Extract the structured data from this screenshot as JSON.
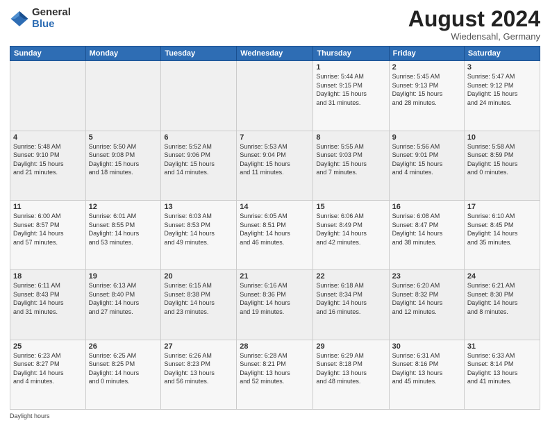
{
  "header": {
    "logo_general": "General",
    "logo_blue": "Blue",
    "title": "August 2024",
    "location": "Wiedensahl, Germany"
  },
  "days_of_week": [
    "Sunday",
    "Monday",
    "Tuesday",
    "Wednesday",
    "Thursday",
    "Friday",
    "Saturday"
  ],
  "weeks": [
    [
      {
        "day": "",
        "info": ""
      },
      {
        "day": "",
        "info": ""
      },
      {
        "day": "",
        "info": ""
      },
      {
        "day": "",
        "info": ""
      },
      {
        "day": "1",
        "info": "Sunrise: 5:44 AM\nSunset: 9:15 PM\nDaylight: 15 hours\nand 31 minutes."
      },
      {
        "day": "2",
        "info": "Sunrise: 5:45 AM\nSunset: 9:13 PM\nDaylight: 15 hours\nand 28 minutes."
      },
      {
        "day": "3",
        "info": "Sunrise: 5:47 AM\nSunset: 9:12 PM\nDaylight: 15 hours\nand 24 minutes."
      }
    ],
    [
      {
        "day": "4",
        "info": "Sunrise: 5:48 AM\nSunset: 9:10 PM\nDaylight: 15 hours\nand 21 minutes."
      },
      {
        "day": "5",
        "info": "Sunrise: 5:50 AM\nSunset: 9:08 PM\nDaylight: 15 hours\nand 18 minutes."
      },
      {
        "day": "6",
        "info": "Sunrise: 5:52 AM\nSunset: 9:06 PM\nDaylight: 15 hours\nand 14 minutes."
      },
      {
        "day": "7",
        "info": "Sunrise: 5:53 AM\nSunset: 9:04 PM\nDaylight: 15 hours\nand 11 minutes."
      },
      {
        "day": "8",
        "info": "Sunrise: 5:55 AM\nSunset: 9:03 PM\nDaylight: 15 hours\nand 7 minutes."
      },
      {
        "day": "9",
        "info": "Sunrise: 5:56 AM\nSunset: 9:01 PM\nDaylight: 15 hours\nand 4 minutes."
      },
      {
        "day": "10",
        "info": "Sunrise: 5:58 AM\nSunset: 8:59 PM\nDaylight: 15 hours\nand 0 minutes."
      }
    ],
    [
      {
        "day": "11",
        "info": "Sunrise: 6:00 AM\nSunset: 8:57 PM\nDaylight: 14 hours\nand 57 minutes."
      },
      {
        "day": "12",
        "info": "Sunrise: 6:01 AM\nSunset: 8:55 PM\nDaylight: 14 hours\nand 53 minutes."
      },
      {
        "day": "13",
        "info": "Sunrise: 6:03 AM\nSunset: 8:53 PM\nDaylight: 14 hours\nand 49 minutes."
      },
      {
        "day": "14",
        "info": "Sunrise: 6:05 AM\nSunset: 8:51 PM\nDaylight: 14 hours\nand 46 minutes."
      },
      {
        "day": "15",
        "info": "Sunrise: 6:06 AM\nSunset: 8:49 PM\nDaylight: 14 hours\nand 42 minutes."
      },
      {
        "day": "16",
        "info": "Sunrise: 6:08 AM\nSunset: 8:47 PM\nDaylight: 14 hours\nand 38 minutes."
      },
      {
        "day": "17",
        "info": "Sunrise: 6:10 AM\nSunset: 8:45 PM\nDaylight: 14 hours\nand 35 minutes."
      }
    ],
    [
      {
        "day": "18",
        "info": "Sunrise: 6:11 AM\nSunset: 8:43 PM\nDaylight: 14 hours\nand 31 minutes."
      },
      {
        "day": "19",
        "info": "Sunrise: 6:13 AM\nSunset: 8:40 PM\nDaylight: 14 hours\nand 27 minutes."
      },
      {
        "day": "20",
        "info": "Sunrise: 6:15 AM\nSunset: 8:38 PM\nDaylight: 14 hours\nand 23 minutes."
      },
      {
        "day": "21",
        "info": "Sunrise: 6:16 AM\nSunset: 8:36 PM\nDaylight: 14 hours\nand 19 minutes."
      },
      {
        "day": "22",
        "info": "Sunrise: 6:18 AM\nSunset: 8:34 PM\nDaylight: 14 hours\nand 16 minutes."
      },
      {
        "day": "23",
        "info": "Sunrise: 6:20 AM\nSunset: 8:32 PM\nDaylight: 14 hours\nand 12 minutes."
      },
      {
        "day": "24",
        "info": "Sunrise: 6:21 AM\nSunset: 8:30 PM\nDaylight: 14 hours\nand 8 minutes."
      }
    ],
    [
      {
        "day": "25",
        "info": "Sunrise: 6:23 AM\nSunset: 8:27 PM\nDaylight: 14 hours\nand 4 minutes."
      },
      {
        "day": "26",
        "info": "Sunrise: 6:25 AM\nSunset: 8:25 PM\nDaylight: 14 hours\nand 0 minutes."
      },
      {
        "day": "27",
        "info": "Sunrise: 6:26 AM\nSunset: 8:23 PM\nDaylight: 13 hours\nand 56 minutes."
      },
      {
        "day": "28",
        "info": "Sunrise: 6:28 AM\nSunset: 8:21 PM\nDaylight: 13 hours\nand 52 minutes."
      },
      {
        "day": "29",
        "info": "Sunrise: 6:29 AM\nSunset: 8:18 PM\nDaylight: 13 hours\nand 48 minutes."
      },
      {
        "day": "30",
        "info": "Sunrise: 6:31 AM\nSunset: 8:16 PM\nDaylight: 13 hours\nand 45 minutes."
      },
      {
        "day": "31",
        "info": "Sunrise: 6:33 AM\nSunset: 8:14 PM\nDaylight: 13 hours\nand 41 minutes."
      }
    ]
  ],
  "footer": {
    "daylight_label": "Daylight hours"
  }
}
